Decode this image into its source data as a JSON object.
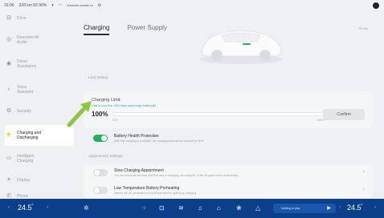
{
  "status_bar": {
    "time": "16:06",
    "left_text": "328 km  83  90%",
    "center_text": "Automatic\nclimate on",
    "icons": [
      "signal-icon",
      "wifi-icon",
      "bluetooth-icon",
      "settings-icon"
    ]
  },
  "sidebar": {
    "items": [
      {
        "label": "Drive",
        "icon": "car-icon"
      },
      {
        "label": "Rearview All\nAudio",
        "icon": "speaker-icon"
      },
      {
        "label": "Driver\nAssistance",
        "icon": "steering-icon"
      },
      {
        "label": "Voice\nAssistant",
        "icon": "mic-icon"
      },
      {
        "label": "Security",
        "icon": "gear-icon"
      },
      {
        "label": "Charging and\nDischarging",
        "icon": "plug-icon",
        "active": true
      },
      {
        "label": "Intelligent\nCharging",
        "icon": "battery-icon"
      },
      {
        "label": "Display",
        "icon": "sun-icon"
      },
      {
        "label": "Phone",
        "icon": "phone-icon"
      }
    ]
  },
  "tabs": [
    {
      "label": "Charging",
      "active": true
    },
    {
      "label": "Power Supply",
      "active": false
    }
  ],
  "top_right": "☰ Info",
  "sections": {
    "limit_label": "Limit setting",
    "appointment_label": "Appointment Settings"
  },
  "charging_limit": {
    "title": "Charging Limit",
    "subtitle": "Limit to your fine, 90% helps keep longer battery life",
    "percent_text": "100%",
    "level": 1.0,
    "min_label": "50%",
    "max_label": "100%",
    "confirm_label": "Confirm"
  },
  "battery_health": {
    "title": "Battery Health Protection",
    "desc": "After the charging is complete, the charging limit will be restored to 90%.",
    "enabled": true
  },
  "appointments": [
    {
      "title": "Slow Charging Appointment",
      "desc": "You can schedule the start and end time of charging, for example, in the off-peak hours of electricity.",
      "enabled": false
    },
    {
      "title": "Low Temperature Battery Preheating",
      "desc": "Battery will be preheated at low temperature to speed up charging.",
      "enabled": false
    }
  ],
  "dock": {
    "left_temp": "24.5",
    "right_temp": "24.5",
    "temp_unit": "°",
    "media_text": "Nothing to play",
    "icons": [
      "fan-icon",
      "apps-icon",
      "car-icon",
      "seat-heat-icon",
      "music-icon",
      "home-icon",
      "climate-icon",
      "navigation-icon"
    ]
  },
  "colors": {
    "accent_green": "#22b158",
    "dock_blue": "#0c3f8a",
    "link_cyan": "#1ea9c9",
    "arrow_green": "#8dc63f"
  }
}
